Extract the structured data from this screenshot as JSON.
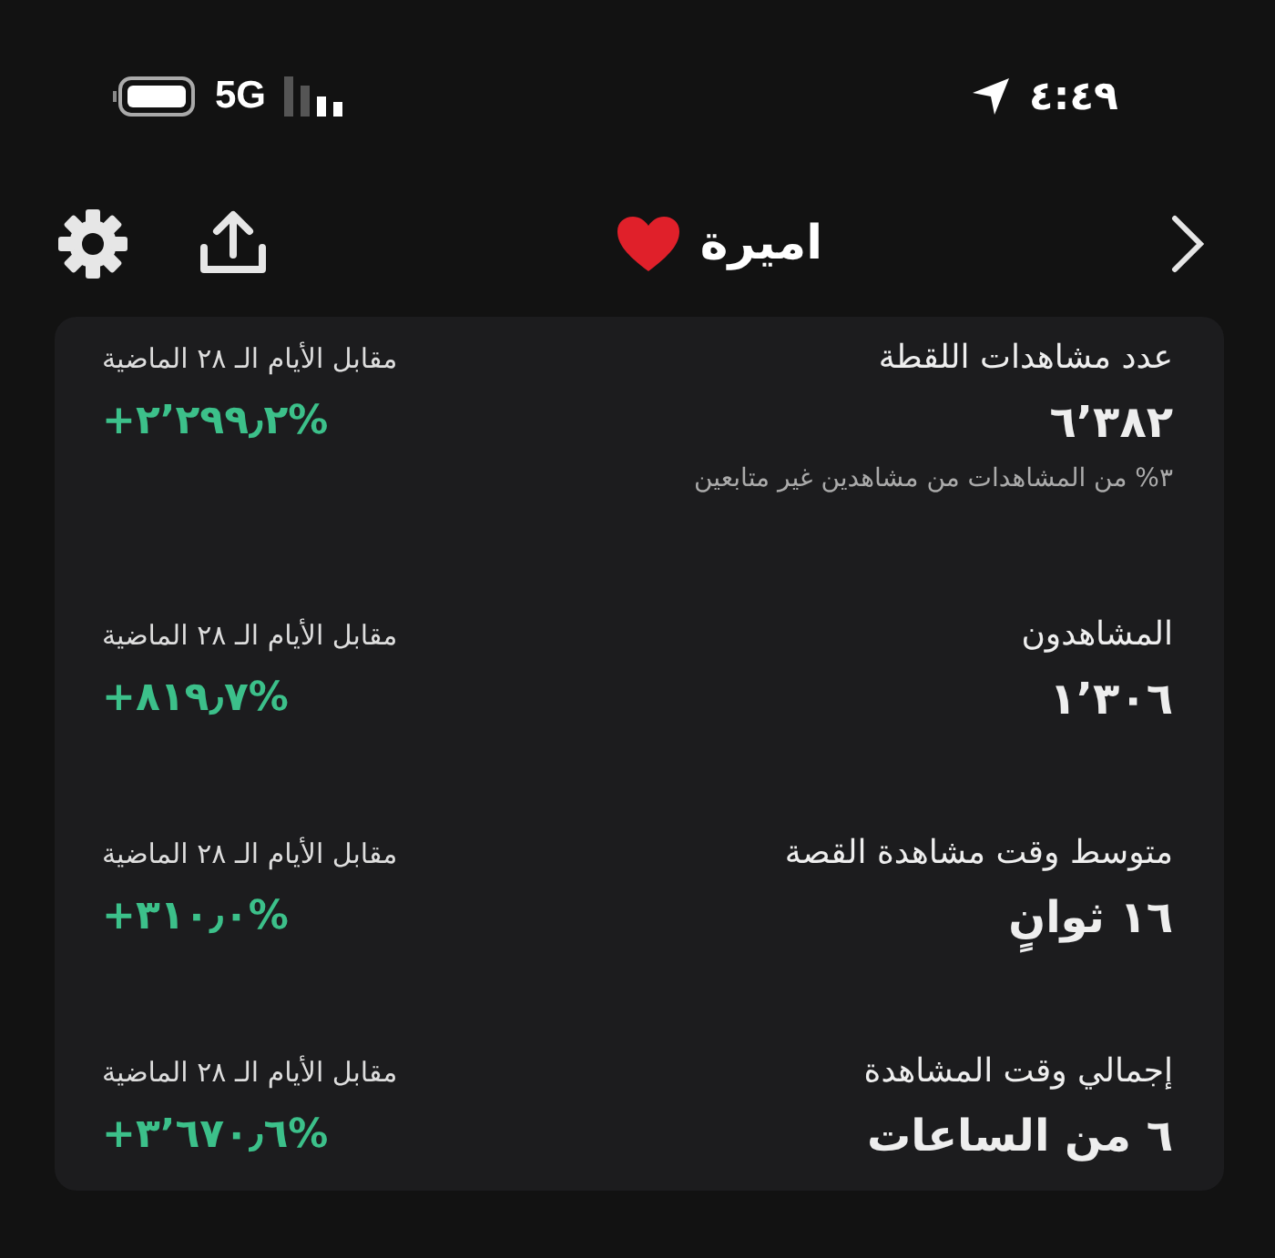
{
  "status_bar": {
    "network": "5G",
    "time": "٤:٤٩"
  },
  "header": {
    "title": "اميرة"
  },
  "metrics": [
    {
      "label": "عدد مشاهدات اللقطة",
      "value": "٦٬٣٨٢",
      "note": "٣% من المشاهدات من مشاهدين غير متابعين",
      "compare_label": "مقابل الأيام الـ ٢٨ الماضية",
      "change": "+٢٬٢٩٩٫٢%"
    },
    {
      "label": "المشاهدون",
      "value": "١٬٣٠٦",
      "compare_label": "مقابل الأيام الـ ٢٨ الماضية",
      "change": "+٨١٩٫٧%"
    },
    {
      "label": "متوسط وقت مشاهدة القصة",
      "value": "١٦ ثوانٍ",
      "compare_label": "مقابل الأيام الـ ٢٨ الماضية",
      "change": "+٣١٠٫٠%"
    },
    {
      "label": "إجمالي وقت المشاهدة",
      "value": "٦ من الساعات",
      "compare_label": "مقابل الأيام الـ ٢٨ الماضية",
      "change": "+٣٬٦٧٠٫٦%"
    }
  ]
}
